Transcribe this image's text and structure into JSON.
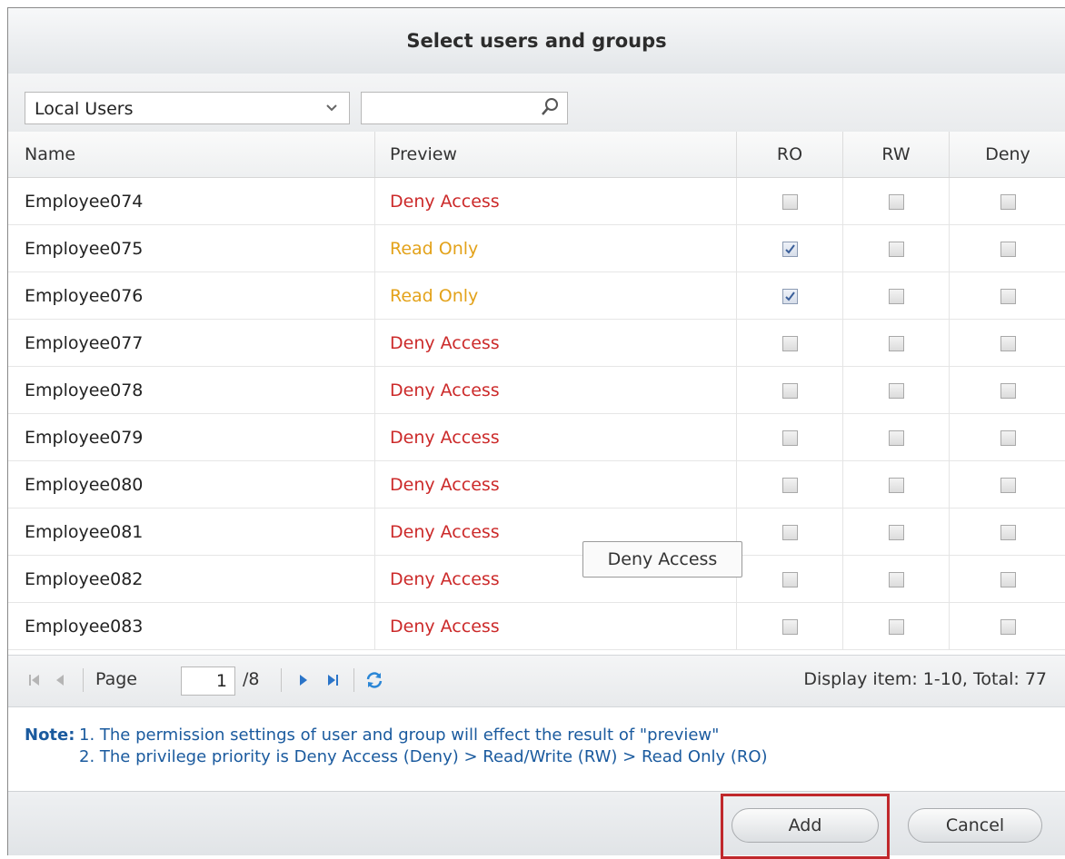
{
  "dialog": {
    "title": "Select users and groups"
  },
  "filter": {
    "selected": "Local Users",
    "search_value": ""
  },
  "columns": {
    "name": "Name",
    "preview": "Preview",
    "ro": "RO",
    "rw": "RW",
    "deny": "Deny"
  },
  "rows": [
    {
      "name": "Employee074",
      "preview": "Deny Access",
      "preview_type": "deny",
      "ro": false,
      "rw": false,
      "deny": false
    },
    {
      "name": "Employee075",
      "preview": "Read Only",
      "preview_type": "ro",
      "ro": true,
      "rw": false,
      "deny": false
    },
    {
      "name": "Employee076",
      "preview": "Read Only",
      "preview_type": "ro",
      "ro": true,
      "rw": false,
      "deny": false
    },
    {
      "name": "Employee077",
      "preview": "Deny Access",
      "preview_type": "deny",
      "ro": false,
      "rw": false,
      "deny": false
    },
    {
      "name": "Employee078",
      "preview": "Deny Access",
      "preview_type": "deny",
      "ro": false,
      "rw": false,
      "deny": false
    },
    {
      "name": "Employee079",
      "preview": "Deny Access",
      "preview_type": "deny",
      "ro": false,
      "rw": false,
      "deny": false
    },
    {
      "name": "Employee080",
      "preview": "Deny Access",
      "preview_type": "deny",
      "ro": false,
      "rw": false,
      "deny": false
    },
    {
      "name": "Employee081",
      "preview": "Deny Access",
      "preview_type": "deny",
      "ro": false,
      "rw": false,
      "deny": false
    },
    {
      "name": "Employee082",
      "preview": "Deny Access",
      "preview_type": "deny",
      "ro": false,
      "rw": false,
      "deny": false
    },
    {
      "name": "Employee083",
      "preview": "Deny Access",
      "preview_type": "deny",
      "ro": false,
      "rw": false,
      "deny": false
    }
  ],
  "tooltip": {
    "text": "Deny Access"
  },
  "pager": {
    "page_label": "Page",
    "page_value": "1",
    "total_pages": "/8",
    "display": "Display item: 1-10, Total: 77"
  },
  "note": {
    "label": "Note:",
    "line1": "1. The permission settings of user and group will effect the result of \"preview\"",
    "line2": "2. The privilege priority is Deny Access (Deny) > Read/Write (RW) > Read Only (RO)"
  },
  "buttons": {
    "add": "Add",
    "cancel": "Cancel"
  },
  "colors": {
    "deny": "#cc2a2a",
    "read_only": "#e3a21a",
    "note": "#1a5a9e",
    "highlight": "#c0282c"
  },
  "icons": {
    "dropdown": "chevron-down-icon",
    "search": "search-icon",
    "first": "first-page-icon",
    "prev": "prev-page-icon",
    "next": "next-page-icon",
    "last": "last-page-icon",
    "refresh": "refresh-icon",
    "check": "checkmark-icon"
  }
}
